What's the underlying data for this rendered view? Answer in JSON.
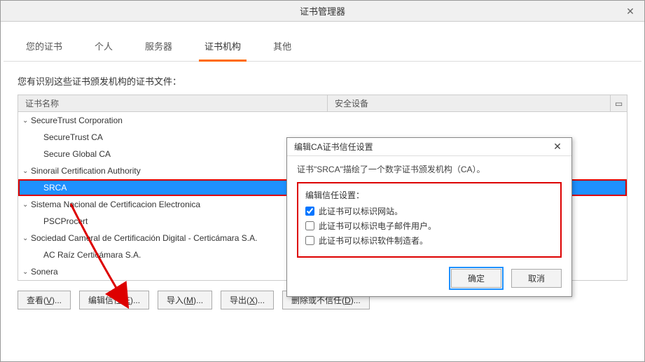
{
  "window": {
    "title": "证书管理器"
  },
  "tabs": [
    {
      "label": "您的证书",
      "active": false
    },
    {
      "label": "个人",
      "active": false
    },
    {
      "label": "服务器",
      "active": false
    },
    {
      "label": "证书机构",
      "active": true
    },
    {
      "label": "其他",
      "active": false
    }
  ],
  "description": "您有识别这些证书颁发机构的证书文件：",
  "columns": {
    "name": "证书名称",
    "device": "安全设备",
    "more": "�ເ"
  },
  "tree": [
    {
      "type": "group",
      "label": "SecureTrust Corporation"
    },
    {
      "type": "child",
      "label": "SecureTrust CA"
    },
    {
      "type": "child",
      "label": "Secure Global CA"
    },
    {
      "type": "group",
      "label": "Sinorail Certification Authority"
    },
    {
      "type": "child",
      "label": "SRCA",
      "selected": true,
      "highlight": true
    },
    {
      "type": "group",
      "label": "Sistema Nacional de Certificacion Electronica"
    },
    {
      "type": "child",
      "label": "PSCProcert"
    },
    {
      "type": "group",
      "label": "Sociedad Cameral de Certificación Digital - Certicámara S.A."
    },
    {
      "type": "child",
      "label": "AC Raíz Certicámara S.A."
    },
    {
      "type": "group",
      "label": "Sonera"
    }
  ],
  "buttons": {
    "view": {
      "text": "查看(",
      "key": "V",
      "suffix": ")..."
    },
    "edit": {
      "text": "编辑信任(",
      "key": "E",
      "suffix": ")...",
      "highlight": true
    },
    "import": {
      "text": "导入(",
      "key": "M",
      "suffix": ")..."
    },
    "export": {
      "text": "导出(",
      "key": "X",
      "suffix": ")..."
    },
    "delete": {
      "text": "删除或不信任(",
      "key": "D",
      "suffix": ")..."
    }
  },
  "dialog": {
    "title": "编辑CA证书信任设置",
    "hint": "证书\"SRCA\"描绘了一个数字证书颁发机构（CA）。",
    "opt_header": "编辑信任设置：",
    "opts": [
      {
        "label": "此证书可以标识网站。",
        "checked": true
      },
      {
        "label": "此证书可以标识电子邮件用户。",
        "checked": false
      },
      {
        "label": "此证书可以标识软件制造者。",
        "checked": false
      }
    ],
    "ok": "确定",
    "cancel": "取消"
  }
}
